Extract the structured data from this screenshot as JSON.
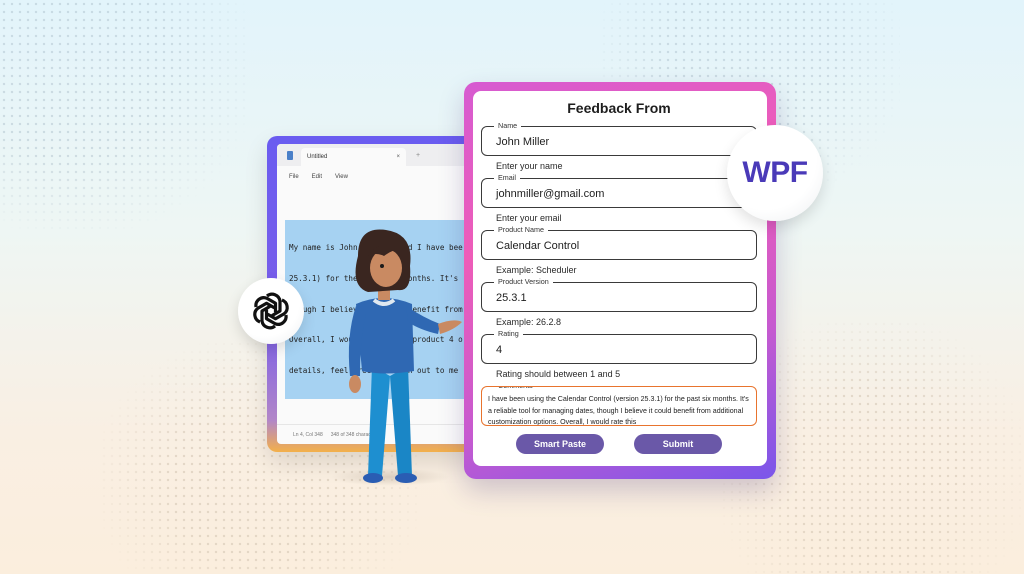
{
  "notepad": {
    "tab_title": "Untitled",
    "tab_close": "×",
    "new_tab": "+",
    "menu": [
      "File",
      "Edit",
      "View"
    ],
    "selected_text_lines": [
      "My name is John Miller, and I have bee",
      "25.3.1) for the past six months. It's",
      "though I believe it could benefit from",
      "Overall, I would rate this product 4 o",
      "details, feel free to reach out to me "
    ],
    "status": {
      "position": "Ln 4, Col 348",
      "characters": "348 of 348 characters"
    }
  },
  "badges": {
    "openai": "openai-logo",
    "wpf": "WPF"
  },
  "form": {
    "title": "Feedback From",
    "fields": [
      {
        "label": "Name",
        "value": "John Miller",
        "helper": "Enter your name"
      },
      {
        "label": "Email",
        "value": "johnmiller@gmail.com",
        "helper": "Enter your email"
      },
      {
        "label": "Product Name",
        "value": "Calendar Control",
        "helper": "Example: Scheduler"
      },
      {
        "label": "Product Version",
        "value": "25.3.1",
        "helper": "Example: 26.2.8"
      },
      {
        "label": "Rating",
        "value": "4",
        "helper": "Rating should between 1 and 5"
      }
    ],
    "comments": {
      "label": "Comments",
      "value": "I have been using the Calendar Control (version 25.3.1) for the past six months. It's a reliable tool for managing dates, though I believe it could benefit from additional customization options. Overall, I would rate this"
    },
    "buttons": {
      "smart_paste": "Smart Paste",
      "submit": "Submit"
    },
    "colors": {
      "button": "#6a58a8",
      "comments_focus_border": "#e8742e",
      "wpf_text": "#4a3ab8"
    }
  }
}
